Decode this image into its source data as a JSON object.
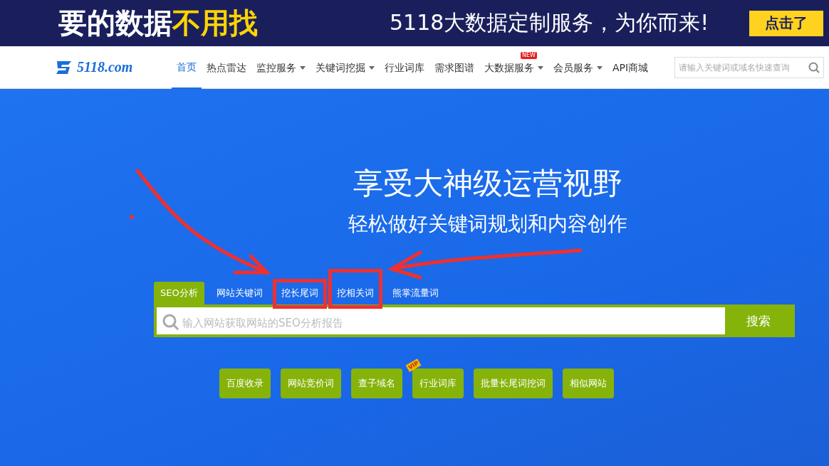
{
  "banner": {
    "headline": "要的数据",
    "headline_highlight": "不用找",
    "tagline": "5118大数据定制服务，为你而来!",
    "cta": "点击了"
  },
  "navbar": {
    "logo": "5118.com",
    "items": [
      {
        "label": "首页",
        "selected": true,
        "dropdown": false
      },
      {
        "label": "热点雷达",
        "selected": false,
        "dropdown": false
      },
      {
        "label": "监控服务",
        "selected": false,
        "dropdown": true
      },
      {
        "label": "关键词挖掘",
        "selected": false,
        "dropdown": true
      },
      {
        "label": "行业词库",
        "selected": false,
        "dropdown": false
      },
      {
        "label": "需求图谱",
        "selected": false,
        "dropdown": false
      },
      {
        "label": "大数据服务",
        "selected": false,
        "dropdown": true,
        "badge": "NEW"
      },
      {
        "label": "会员服务",
        "selected": false,
        "dropdown": true
      },
      {
        "label": "API商城",
        "selected": false,
        "dropdown": false
      }
    ],
    "search": {
      "placeholder": "请输入关键词或域名快速查询"
    }
  },
  "hero": {
    "title": "享受大神级运营视野",
    "subtitle": "轻松做好关键词规划和内容创作"
  },
  "search_tabs": [
    {
      "label": "SEO分析",
      "selected": true
    },
    {
      "label": "网站关键词",
      "selected": false
    },
    {
      "label": "挖长尾词",
      "selected": false
    },
    {
      "label": "挖相关词",
      "selected": false
    },
    {
      "label": "熊掌流量词",
      "selected": false
    }
  ],
  "search": {
    "placeholder": "输入网站获取网站的SEO分析报告",
    "button": "搜索"
  },
  "quick_links": [
    {
      "label": "百度收录"
    },
    {
      "label": "网站竞价词"
    },
    {
      "label": "查子域名"
    },
    {
      "label": "行业词库",
      "badge": "VIP"
    },
    {
      "label": "批量长尾词挖词"
    },
    {
      "label": "相似网站"
    }
  ]
}
